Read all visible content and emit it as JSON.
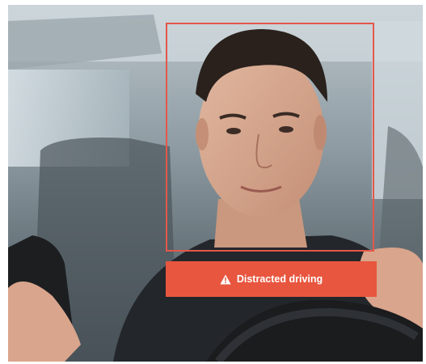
{
  "alert": {
    "label": "Distracted driving",
    "icon": "warning-triangle-icon"
  },
  "colors": {
    "detection_box": "#e4574a",
    "alert_background": "#e8563f",
    "alert_text": "#ffffff"
  }
}
